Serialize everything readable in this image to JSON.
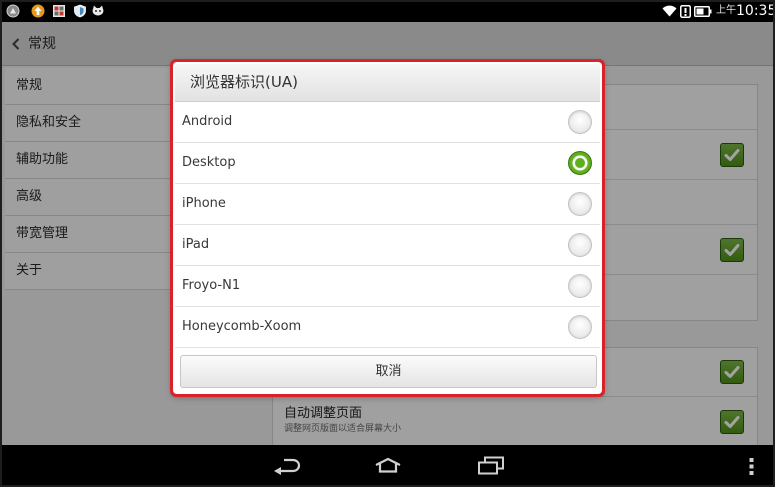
{
  "status_bar": {
    "left_icons": [
      "circle-badge-icon",
      "upload-arrow-icon",
      "grid-app-icon",
      "shield-icon",
      "cat-face-icon"
    ],
    "right_icons": [
      "wifi-icon",
      "alert-box-icon",
      "battery-icon"
    ],
    "am_pm": "上午",
    "time": "10:35"
  },
  "action_bar": {
    "back_icon": "chevron-left-icon",
    "title": "常规"
  },
  "sidebar": {
    "items": [
      {
        "label": "常规"
      },
      {
        "label": "隐私和安全"
      },
      {
        "label": "辅助功能"
      },
      {
        "label": "高级"
      },
      {
        "label": "带宽管理"
      },
      {
        "label": "关于"
      }
    ]
  },
  "settings_panel": {
    "checkboxes": [
      {
        "checked": true
      },
      {
        "checked": true
      },
      {
        "checked": true
      },
      {
        "checked": true
      }
    ],
    "auto_fit": {
      "label": "自动调整页面",
      "summary": "调整网页版面以适合屏幕大小"
    }
  },
  "dialog": {
    "title": "浏览器标识(UA)",
    "options": [
      {
        "label": "Android",
        "selected": false
      },
      {
        "label": "Desktop",
        "selected": true
      },
      {
        "label": "iPhone",
        "selected": false
      },
      {
        "label": "iPad",
        "selected": false
      },
      {
        "label": "Froyo-N1",
        "selected": false
      },
      {
        "label": "Honeycomb-Xoom",
        "selected": false
      }
    ],
    "cancel_label": "取消"
  },
  "nav_bar": {
    "icons": [
      "back-icon",
      "home-icon",
      "recent-apps-icon",
      "overflow-menu-icon"
    ]
  },
  "colors": {
    "accent_green": "#5ca41c",
    "highlight_border": "#d9232b",
    "system_bar": "#000000",
    "scrim": "rgba(0,0,0,0.36)"
  }
}
